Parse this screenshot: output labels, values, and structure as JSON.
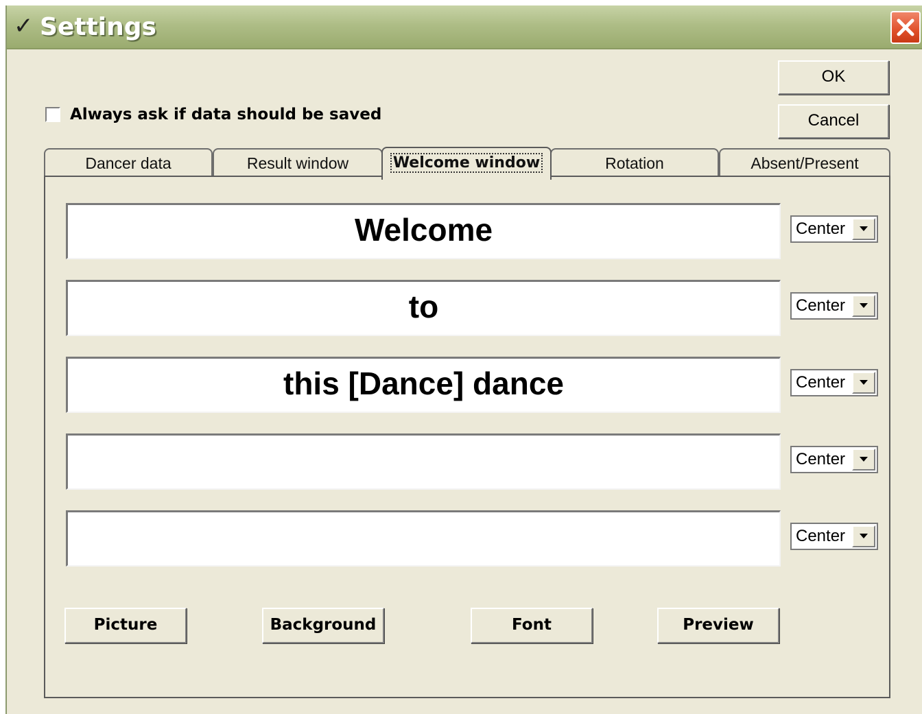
{
  "window": {
    "title_check": "✓",
    "title": "Settings",
    "close_icon": "close-x-icon",
    "close_color": "#e0502a"
  },
  "buttons": {
    "ok": "OK",
    "cancel": "Cancel"
  },
  "always_ask": {
    "label": "Always ask if data should be saved",
    "checked": false
  },
  "tabs": [
    {
      "label": "Dancer data",
      "active": false
    },
    {
      "label": "Result window",
      "active": false
    },
    {
      "label": "Welcome window",
      "active": true
    },
    {
      "label": "Rotation",
      "active": false
    },
    {
      "label": "Absent/Present",
      "active": false
    }
  ],
  "welcome_lines": [
    {
      "text": "Welcome",
      "align": "Center"
    },
    {
      "text": "to",
      "align": "Center"
    },
    {
      "text": "this [Dance] dance",
      "align": "Center"
    },
    {
      "text": "",
      "align": "Center"
    },
    {
      "text": "",
      "align": "Center"
    }
  ],
  "actions": {
    "picture": "Picture",
    "background": "Background",
    "font": "Font",
    "preview": "Preview"
  }
}
